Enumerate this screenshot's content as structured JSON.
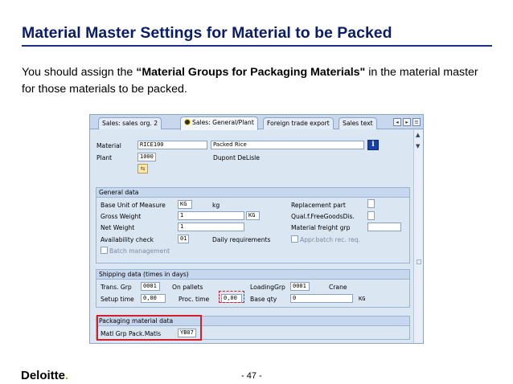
{
  "slide": {
    "title": "Material Master Settings for Material to be Packed",
    "intro_before": "You should assign the ",
    "intro_bold": "“Material Groups for Packaging Materials\"",
    "intro_after": " in the material master for those materials to be packed."
  },
  "sap": {
    "tabs": [
      "Sales: sales org. 2",
      "Sales: General/Plant",
      "Foreign trade export",
      "Sales text"
    ],
    "active_tab": "Sales: General/Plant",
    "header": {
      "material_label": "Material",
      "material_value": "RICE100",
      "material_desc": "Packed Rice",
      "plant_label": "Plant",
      "plant_value": "1000",
      "plant_desc": "Dupont DeLisle"
    },
    "general_data": {
      "title": "General data",
      "base_uom_label": "Base Unit of Measure",
      "base_uom_value": "KG",
      "base_uom_text": "kg",
      "gross_weight_label": "Gross Weight",
      "gross_weight_value": "1",
      "gross_weight_unit": "KG",
      "net_weight_label": "Net Weight",
      "net_weight_value": "1",
      "availability_label": "Availability check",
      "availability_value": "01",
      "availability_text": "Daily requirements",
      "replacement_label": "Replacement part",
      "qual_label": "Qual.f.FreeGoodsDis.",
      "freight_label": "Material freight grp",
      "appr_label": "Appr.batch rec. req.",
      "batch_label": "Batch management"
    },
    "shipping": {
      "title": "Shipping data (times in days)",
      "trans_grp_label": "Trans. Grp",
      "trans_grp_value": "0001",
      "trans_grp_text": "On pallets",
      "loading_label": "LoadingGrp",
      "loading_value": "0001",
      "loading_text": "Crane",
      "setup_label": "Setup time",
      "setup_value": "0,00",
      "proc_label": "Proc. time",
      "proc_value": "0,00",
      "base_qty_label": "Base qty",
      "base_qty_value": "0",
      "base_qty_unit": "KG"
    },
    "packaging": {
      "title": "Packaging material data",
      "matl_grp_label": "Matl Grp Pack.Matls",
      "matl_grp_value": "YB07"
    }
  },
  "footer": {
    "logo_text": "Deloitte",
    "logo_dot": ".",
    "page_number": "- 47 -"
  },
  "colors": {
    "title": "#0a1d6b",
    "highlight": "#d1202a",
    "brand_green": "#86bc25"
  }
}
